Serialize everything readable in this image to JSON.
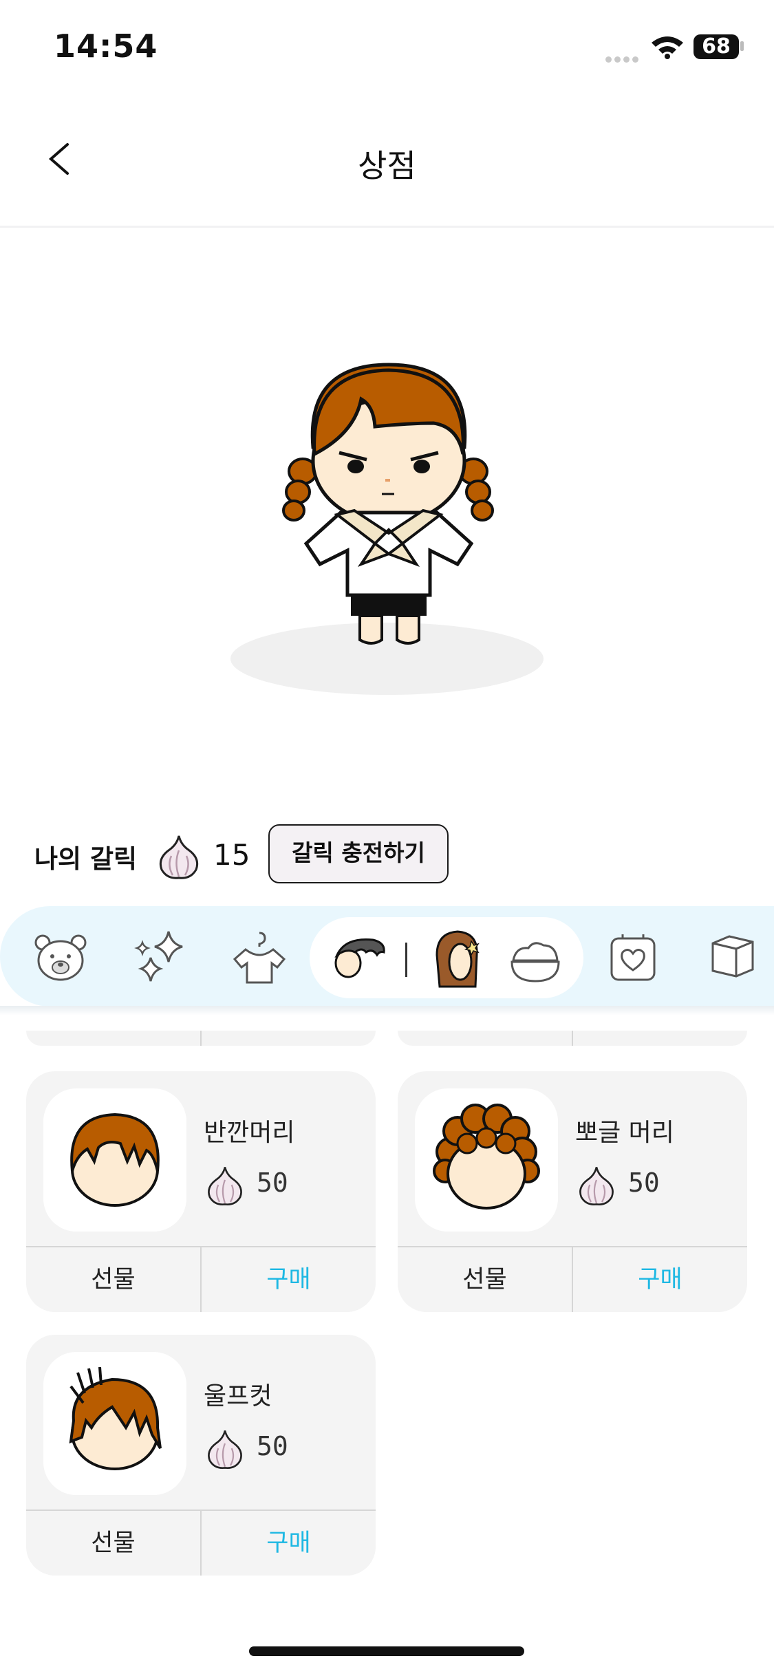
{
  "status_bar": {
    "time": "14:54",
    "battery": "68"
  },
  "nav": {
    "title": "상점"
  },
  "wallet": {
    "label": "나의 갈릭",
    "count": "15",
    "charge_label": "갈릭 충전하기"
  },
  "categories": [
    "bear-icon",
    "sparkles-icon",
    "hanger-icon",
    "hair-front-icon",
    "hair-back-icon",
    "face-cream-icon",
    "frame-icon",
    "box-icon"
  ],
  "items": [
    {
      "name": "반깐머리",
      "price": "50",
      "gift_label": "선물",
      "buy_label": "구매"
    },
    {
      "name": "뽀글 머리",
      "price": "50",
      "gift_label": "선물",
      "buy_label": "구매"
    },
    {
      "name": "울프컷",
      "price": "50",
      "gift_label": "선물",
      "buy_label": "구매"
    }
  ],
  "colors": {
    "accent": "#1eb8e3",
    "hair": "#b85c00",
    "category_bg": "#e9f7fd"
  }
}
